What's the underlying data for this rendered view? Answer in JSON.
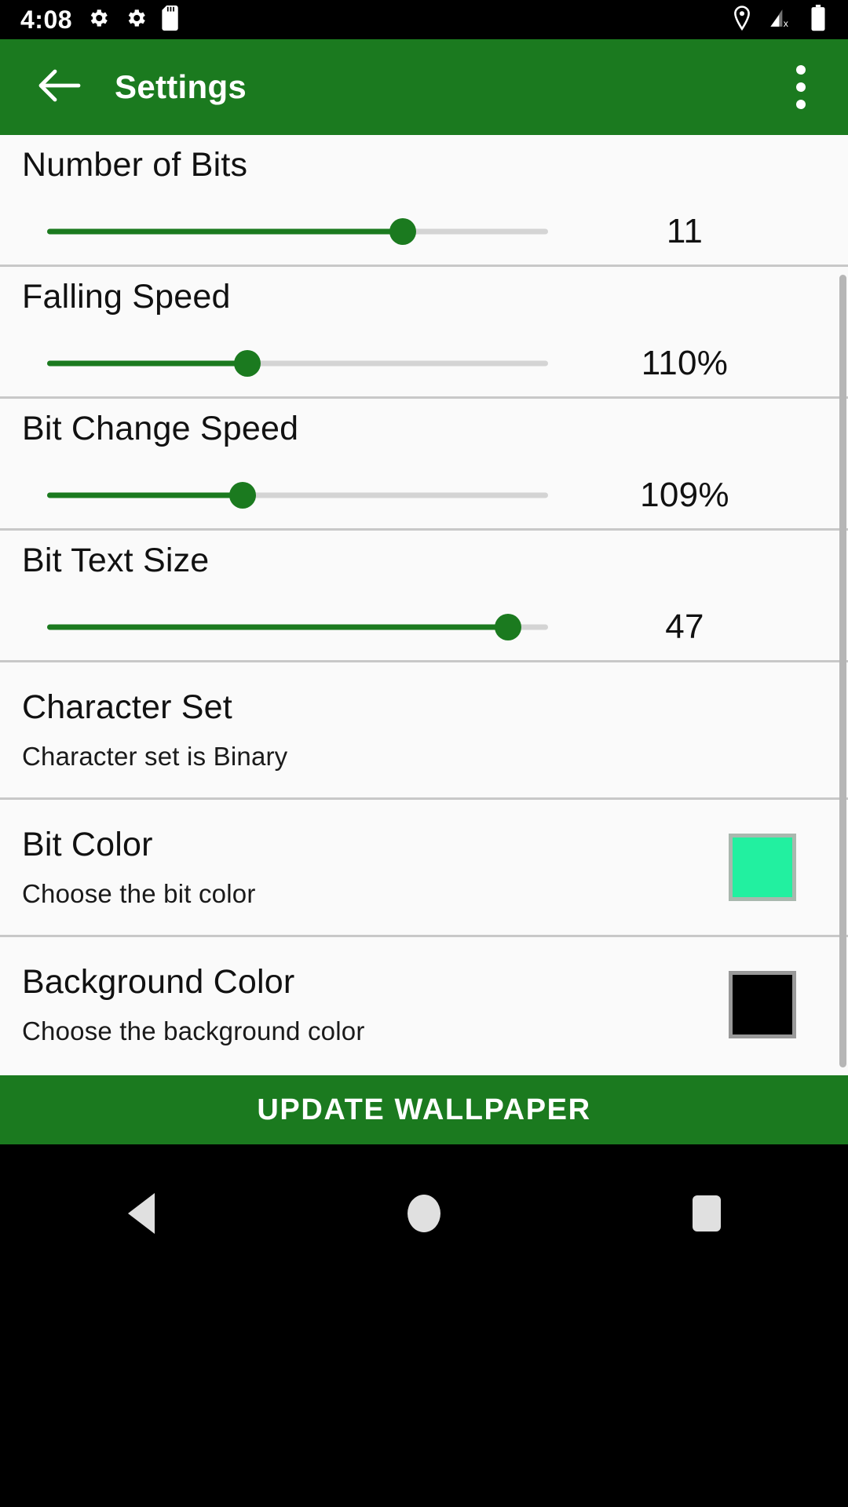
{
  "status_bar": {
    "time": "4:08",
    "left_icons": [
      "gear-icon",
      "gear-icon",
      "sd-card-icon"
    ],
    "right_icons": [
      "location-pin-icon",
      "signal-no-service-icon",
      "battery-full-icon"
    ]
  },
  "app_bar": {
    "back_label": "back-arrow",
    "title": "Settings",
    "overflow_label": "more-options"
  },
  "theme": {
    "primary_green": "#1B7A1F",
    "page_background": "#fafafa",
    "divider": "#c8c8c8"
  },
  "settings": [
    {
      "type": "slider",
      "title": "Number of Bits",
      "value_label": "11",
      "fill_percent": 71
    },
    {
      "type": "slider",
      "title": "Falling Speed",
      "value_label": "110%",
      "fill_percent": 40
    },
    {
      "type": "slider",
      "title": "Bit Change Speed",
      "value_label": "109%",
      "fill_percent": 39
    },
    {
      "type": "slider",
      "title": "Bit Text Size",
      "value_label": "47",
      "fill_percent": 92
    },
    {
      "type": "text",
      "title": "Character Set",
      "subtitle": "Character set is Binary"
    },
    {
      "type": "color",
      "title": "Bit Color",
      "subtitle": "Choose the bit color",
      "swatch_color": "#22F0A0"
    },
    {
      "type": "color",
      "title": "Background Color",
      "subtitle": "Choose the background color",
      "swatch_color": "#000000"
    }
  ],
  "update_button": {
    "label": "UPDATE WALLPAPER"
  },
  "nav_bar": {
    "back": "back-triangle",
    "home": "home-circle",
    "recents": "recents-square"
  }
}
